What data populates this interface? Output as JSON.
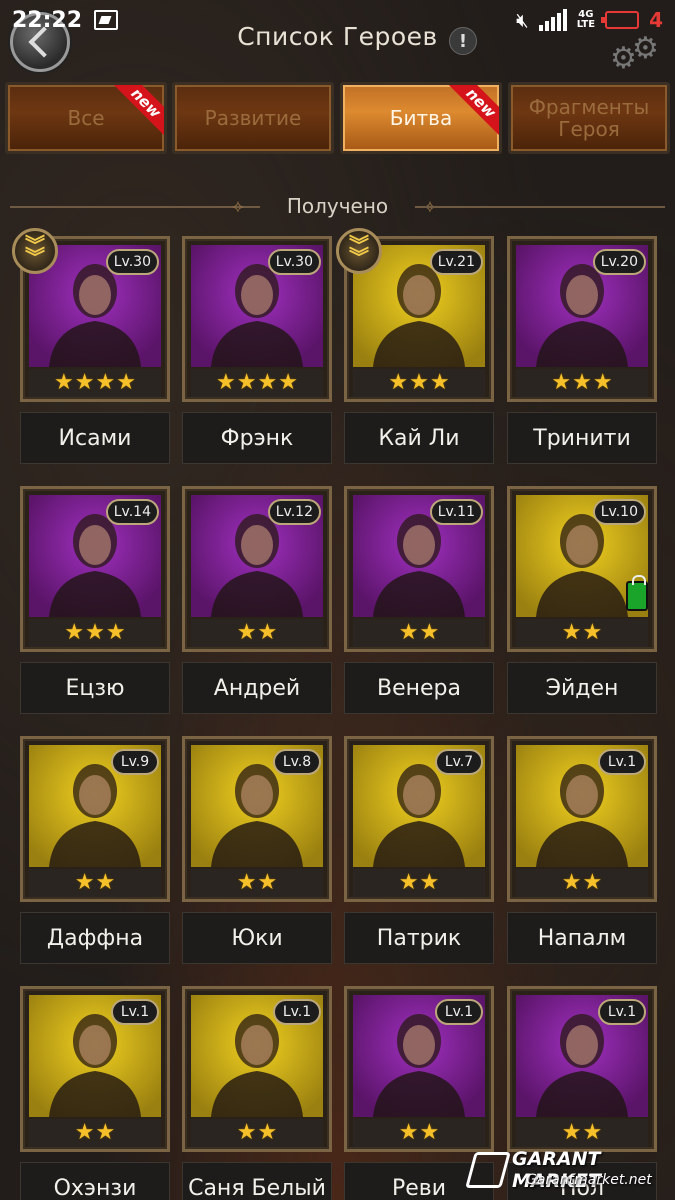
{
  "status_bar": {
    "time": "22:22",
    "network": "4G\nLTE",
    "battery_level": "4"
  },
  "header": {
    "title": "Список Героев",
    "info_label": "!"
  },
  "tabs": [
    {
      "label": "Все",
      "badge": "new",
      "active": false
    },
    {
      "label": "Развитие",
      "badge": "",
      "active": false
    },
    {
      "label": "Битва",
      "badge": "new",
      "active": true
    },
    {
      "label": "Фрагменты Героя",
      "badge": "",
      "active": false
    }
  ],
  "section": {
    "title": "Получено"
  },
  "heroes": [
    {
      "name": "Исами",
      "level": "Lv.30",
      "stars": 4,
      "bg": "purple",
      "rank_badge": true,
      "equip": false
    },
    {
      "name": "Фрэнк",
      "level": "Lv.30",
      "stars": 4,
      "bg": "purple",
      "rank_badge": false,
      "equip": false
    },
    {
      "name": "Кай Ли",
      "level": "Lv.21",
      "stars": 3,
      "bg": "yellow",
      "rank_badge": true,
      "equip": false
    },
    {
      "name": "Тринити",
      "level": "Lv.20",
      "stars": 3,
      "bg": "purple",
      "rank_badge": false,
      "equip": false
    },
    {
      "name": "Ецзю",
      "level": "Lv.14",
      "stars": 3,
      "bg": "purple",
      "rank_badge": false,
      "equip": false
    },
    {
      "name": "Андрей",
      "level": "Lv.12",
      "stars": 2,
      "bg": "purple",
      "rank_badge": false,
      "equip": false
    },
    {
      "name": "Венера",
      "level": "Lv.11",
      "stars": 2,
      "bg": "purple",
      "rank_badge": false,
      "equip": false
    },
    {
      "name": "Эйден",
      "level": "Lv.10",
      "stars": 2,
      "bg": "yellow",
      "rank_badge": false,
      "equip": true
    },
    {
      "name": "Даффна",
      "level": "Lv.9",
      "stars": 2,
      "bg": "yellow",
      "rank_badge": false,
      "equip": false
    },
    {
      "name": "Юки",
      "level": "Lv.8",
      "stars": 2,
      "bg": "yellow",
      "rank_badge": false,
      "equip": false
    },
    {
      "name": "Патрик",
      "level": "Lv.7",
      "stars": 2,
      "bg": "yellow",
      "rank_badge": false,
      "equip": false
    },
    {
      "name": "Напалм",
      "level": "Lv.1",
      "stars": 2,
      "bg": "yellow",
      "rank_badge": false,
      "equip": false
    },
    {
      "name": "Охэнзи",
      "level": "Lv.1",
      "stars": 2,
      "bg": "yellow",
      "rank_badge": false,
      "equip": false
    },
    {
      "name": "Саня Белый",
      "level": "Lv.1",
      "stars": 2,
      "bg": "yellow",
      "rank_badge": false,
      "equip": false
    },
    {
      "name": "Реви",
      "level": "Lv.1",
      "stars": 2,
      "bg": "purple",
      "rank_badge": false,
      "equip": false
    },
    {
      "name": "Пол",
      "level": "Lv.1",
      "stars": 2,
      "bg": "purple",
      "rank_badge": false,
      "equip": false
    }
  ],
  "watermark": {
    "title": "GARANT MARKET",
    "subtitle": "Garantmarket.net"
  },
  "colors": {
    "tab_active": "#dd8a30",
    "tab_inactive": "#6e3712",
    "star": "#f6c02a",
    "portrait_purple": "#a030c0",
    "portrait_yellow": "#f0d020",
    "new_ribbon": "#d4141a",
    "battery_alert": "#e53935"
  }
}
